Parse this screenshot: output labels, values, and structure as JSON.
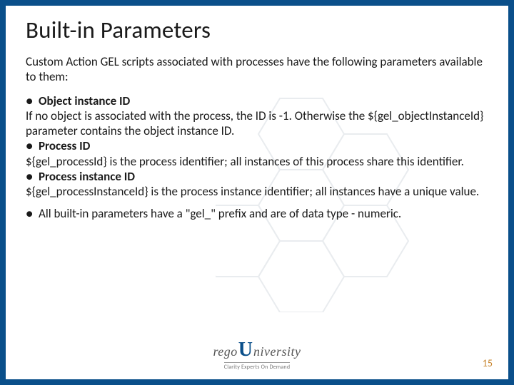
{
  "title": "Built-in Parameters",
  "intro": "Custom Action GEL scripts associated with processes have the following parameters available to them:",
  "params": [
    {
      "name": "Object instance ID",
      "desc": "If no object is associated with the process, the ID is -1. Otherwise the ${gel_objectInstanceId} parameter contains the object instance ID."
    },
    {
      "name": "Process ID",
      "desc": "${gel_processId} is the process identifier; all instances of this process share this identifier."
    },
    {
      "name": "Process instance ID",
      "desc": "${gel_processInstanceId} is the process instance identifier; all instances have a unique value."
    }
  ],
  "note": "All built-in parameters have a \"gel_\" prefix and are of data type - numeric.",
  "logo": {
    "left": "rego",
    "u": "U",
    "right": "niversity",
    "tagline": "Clarity Experts On Demand"
  },
  "page": "15",
  "bullet": "●"
}
